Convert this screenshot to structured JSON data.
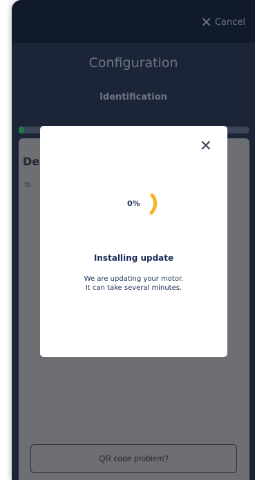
{
  "topbar": {
    "cancel_label": "Cancel"
  },
  "header": {
    "title": "Configuration",
    "subtitle": "Identification"
  },
  "progress": {
    "value_fraction": 0.02,
    "color": "#1e7a4a"
  },
  "card": {
    "title": "De",
    "text": "To",
    "qr_button_label": "QR code problem?"
  },
  "modal": {
    "percent": "0%",
    "title": "Installing update",
    "description_line1": "We are updating your motor.",
    "description_line2": "It can take several minutes.",
    "accent_color": "#f5b324"
  }
}
